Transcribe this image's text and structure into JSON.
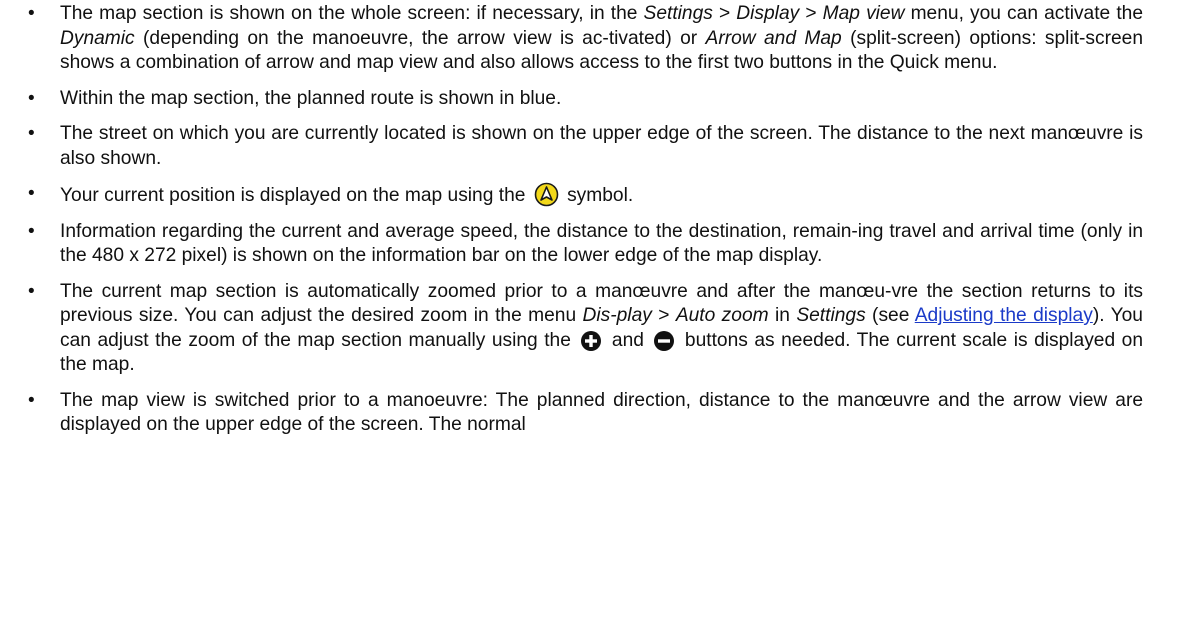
{
  "bullet_char": "•",
  "items": [
    {
      "parts": [
        "The map section is shown on the whole screen: if necessary, in the ",
        "Settings",
        " > ",
        "Display",
        " > ",
        "Map view",
        " menu, you can activate the ",
        "Dynamic",
        " (depending on the manoeuvre, the arrow view is ac-tivated) or ",
        "Arrow and Map",
        " (split-screen) options: split-screen shows a combination of arrow and map view and also allows access to the first two buttons in the Quick menu."
      ]
    },
    {
      "text": "Within the map section, the planned route is shown in blue."
    },
    {
      "text": "The street on which you are currently located is shown on the upper edge of the screen. The distance to the next manœuvre is also shown."
    },
    {
      "before": "Your current position is displayed on the map using the ",
      "icon": "position-arrow-icon",
      "after": " symbol."
    },
    {
      "text": "Information regarding the current and average speed, the distance to the destination, remain-ing travel and arrival time (only in the 480 x 272 pixel) is shown on the information bar on the lower edge of the map display."
    },
    {
      "parts": [
        "The current map section is automatically zoomed prior to a manœuvre and after the manœu-vre the section returns to its previous size. You can adjust the desired zoom in the menu ",
        "Dis-play",
        " > ",
        "Auto zoom",
        " in ",
        "Settings",
        " (see ",
        "Adjusting the display",
        "). You can adjust the zoom of the map section manually using the ",
        " and ",
        " buttons as needed. The current scale is displayed on the map."
      ],
      "icons": [
        "zoom-in-icon",
        "zoom-out-icon"
      ]
    },
    {
      "text": "The map view is switched prior to a manoeuvre: The planned direction, distance to the manœuvre and the arrow view are displayed on the upper edge of the screen. The normal"
    }
  ],
  "colors": {
    "text": "#111111",
    "link": "#1a3ac8",
    "icon_fill": "#f2d81a",
    "icon_outline": "#1a1a1a",
    "zoom_icon_fill": "#111111"
  }
}
